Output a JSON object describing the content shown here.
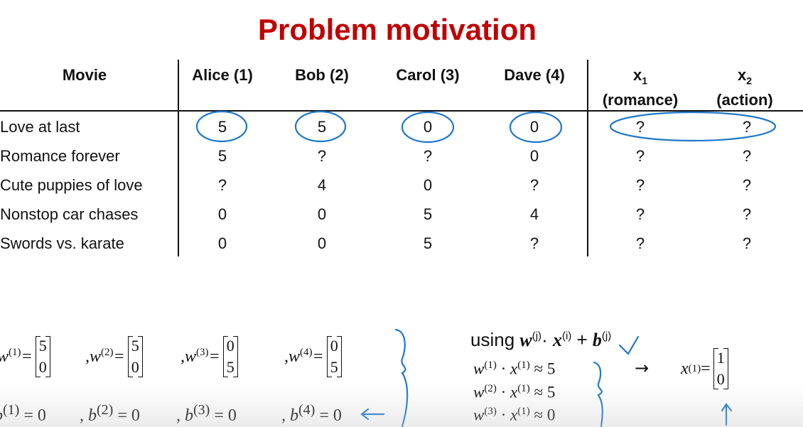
{
  "title": "Problem motivation",
  "table": {
    "headers": {
      "movie": "Movie",
      "users": [
        "Alice (1)",
        "Bob (2)",
        "Carol (3)",
        "Dave (4)"
      ],
      "x1": {
        "sym": "x",
        "sub": "1",
        "label": "(romance)"
      },
      "x2": {
        "sym": "x",
        "sub": "2",
        "label": "(action)"
      }
    },
    "rows": [
      {
        "movie": "Love at last",
        "ratings": [
          "5",
          "5",
          "0",
          "0"
        ],
        "features": [
          "?",
          "?"
        ]
      },
      {
        "movie": "Romance forever",
        "ratings": [
          "5",
          "?",
          "?",
          "0"
        ],
        "features": [
          "?",
          "?"
        ]
      },
      {
        "movie": "Cute puppies of love",
        "ratings": [
          "?",
          "4",
          "0",
          "?"
        ],
        "features": [
          "?",
          "?"
        ]
      },
      {
        "movie": "Nonstop car chases",
        "ratings": [
          "0",
          "0",
          "5",
          "4"
        ],
        "features": [
          "?",
          "?"
        ]
      },
      {
        "movie": "Swords vs. karate",
        "ratings": [
          "0",
          "0",
          "5",
          "?"
        ],
        "features": [
          "?",
          "?"
        ]
      }
    ]
  },
  "weights": [
    {
      "prefix": "w",
      "sup": "(1)",
      "eq": "=",
      "top": "5",
      "bottom": "0"
    },
    {
      "prefix": ",w",
      "sup": "(2)",
      "eq": "=",
      "top": "5",
      "bottom": "0"
    },
    {
      "prefix": ",w",
      "sup": "(3)",
      "eq": "=",
      "top": "0",
      "bottom": "5"
    },
    {
      "prefix": ",w",
      "sup": "(4)",
      "eq": "=",
      "top": "0",
      "bottom": "5"
    }
  ],
  "biases": [
    {
      "prefix": "b",
      "sup": "(1)",
      "rest": " = 0"
    },
    {
      "prefix": ",  b",
      "sup": "(2)",
      "rest": " = 0"
    },
    {
      "prefix": ",  b",
      "sup": "(3)",
      "rest": " = 0"
    },
    {
      "prefix": ",  b",
      "sup": "(4)",
      "rest": " = 0"
    }
  ],
  "using": {
    "word": "using ",
    "w": "w",
    "wsup": "(j)",
    "dot": "· ",
    "x": "x",
    "xsup": "(i)",
    "plus": " + ",
    "b": "b",
    "bsup": "(j)"
  },
  "equations": [
    {
      "w": "w",
      "wsup": "(1)",
      "x": "x",
      "xsup": "(1)",
      "rhs": " ≈ 5"
    },
    {
      "w": "w",
      "wsup": "(2)",
      "x": "x",
      "xsup": "(1)",
      "rhs": " ≈ 5"
    },
    {
      "w": "w",
      "wsup": "(3)",
      "x": "x",
      "xsup": "(1)",
      "rhs": " ≈ 0"
    }
  ],
  "result": {
    "arrow": "→",
    "x": "x",
    "xsup": "(1)",
    "eq": " = ",
    "top": "1",
    "bottom": "0"
  },
  "ink_color": "#1f77c9"
}
